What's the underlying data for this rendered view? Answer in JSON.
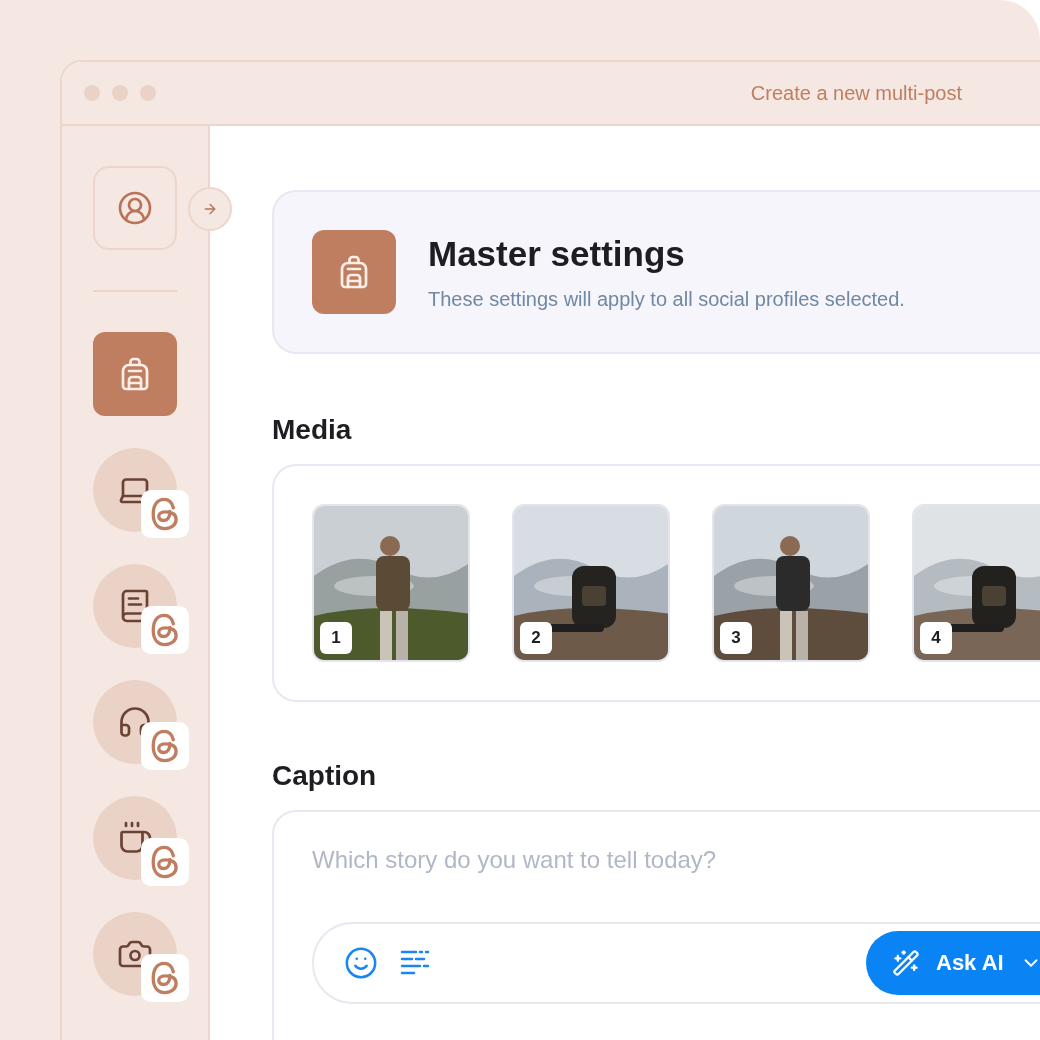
{
  "window": {
    "title": "Create a new multi-post"
  },
  "sidebar": {
    "items": [
      {
        "kind": "master",
        "selected": true
      },
      {
        "kind": "profile",
        "selected": false
      },
      {
        "kind": "profile",
        "selected": false
      },
      {
        "kind": "profile",
        "selected": false
      },
      {
        "kind": "profile",
        "selected": false
      },
      {
        "kind": "profile",
        "selected": false
      }
    ]
  },
  "master_settings": {
    "title": "Master settings",
    "subtitle": "These settings will apply to all social profiles selected."
  },
  "media": {
    "heading": "Media",
    "items": [
      {
        "number": "1"
      },
      {
        "number": "2"
      },
      {
        "number": "3"
      },
      {
        "number": "4"
      }
    ]
  },
  "caption": {
    "heading": "Caption",
    "placeholder": "Which story do you want to tell today?",
    "ask_ai": "Ask AI"
  }
}
